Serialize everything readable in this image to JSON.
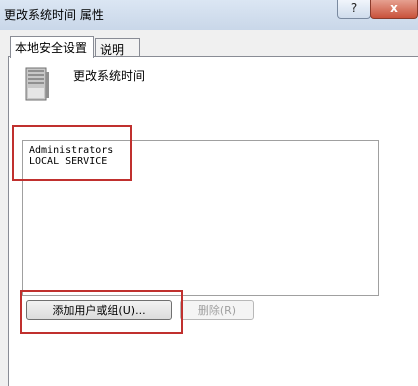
{
  "window": {
    "title": "更改系统时间 属性",
    "help_label": "?",
    "close_label": "x"
  },
  "tabs": [
    {
      "label": "本地安全设置",
      "active": true
    },
    {
      "label": "说明",
      "active": false
    }
  ],
  "policy": {
    "icon": "server-icon",
    "name": "更改系统时间"
  },
  "members": [
    "Administrators",
    "LOCAL SERVICE"
  ],
  "buttons": {
    "add_label": "添加用户或组(U)...",
    "remove_label": "删除(R)"
  },
  "colors": {
    "highlight": "#c0302e",
    "titlebar": "#c9d7e9"
  }
}
